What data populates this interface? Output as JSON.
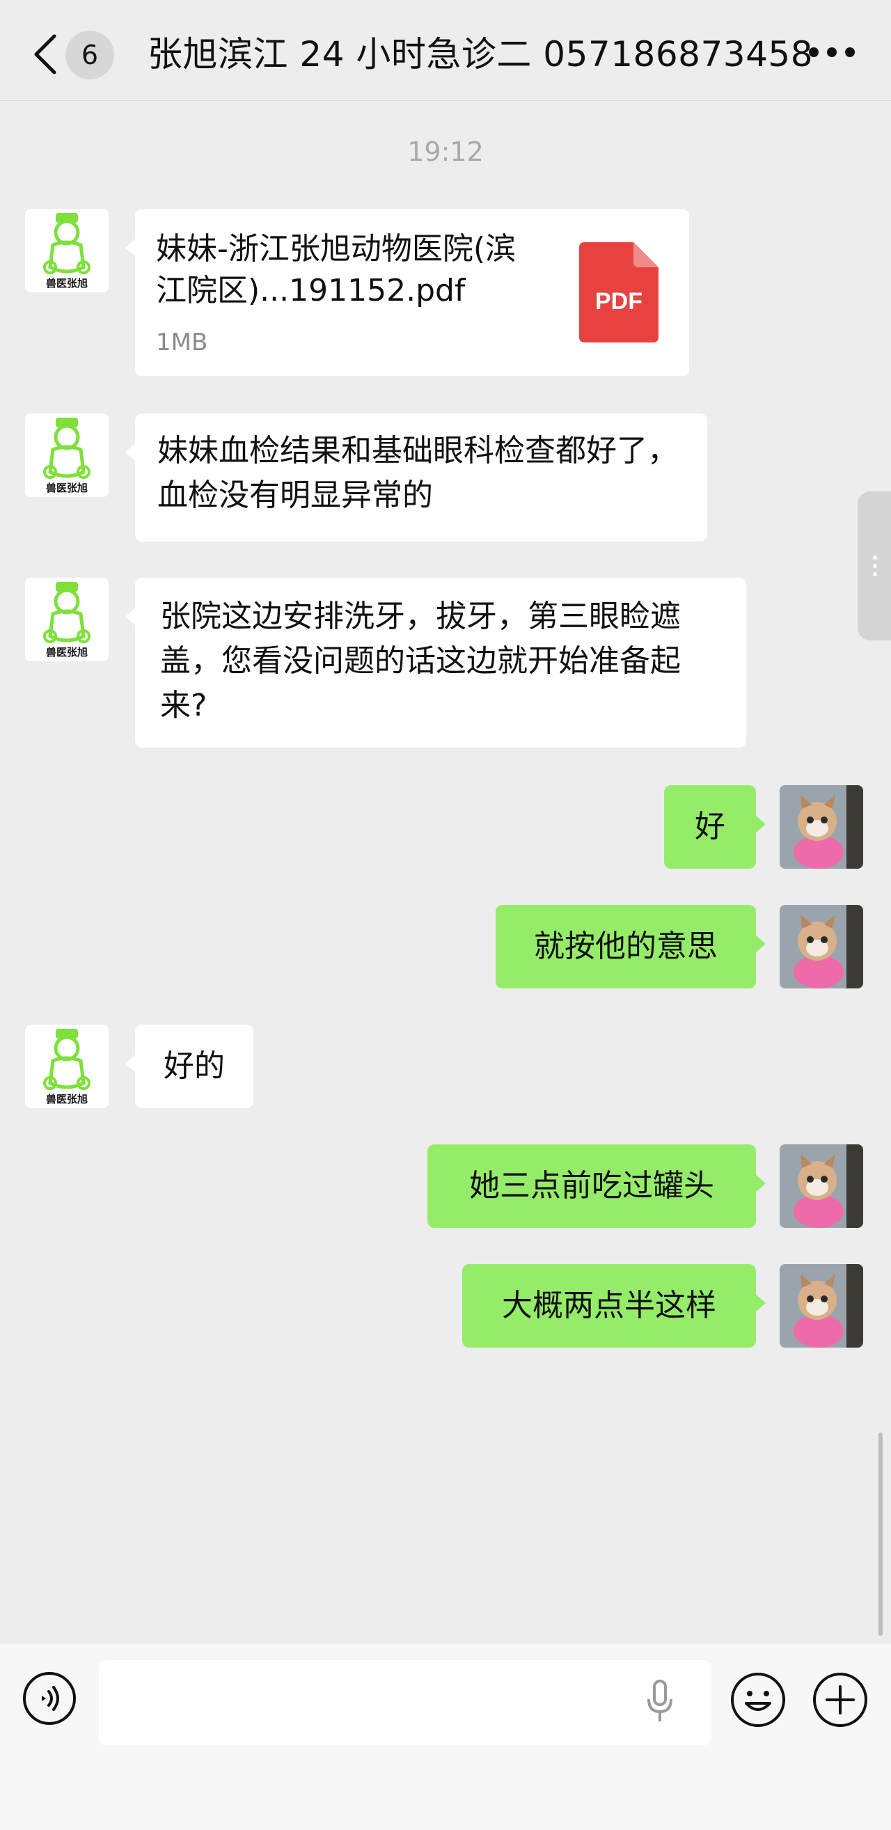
{
  "header": {
    "unread_count": "6",
    "title": "张旭滨江 24 小时急诊二 057186873458"
  },
  "timestamp": "19:12",
  "messages": [
    {
      "sender": "doctor",
      "type": "file",
      "file_name": "妹妹-浙江张旭动物医院(滨江院区)...191152.pdf",
      "file_size": "1MB",
      "file_icon": "PDF"
    },
    {
      "sender": "doctor",
      "type": "text",
      "text": "妹妹血检结果和基础眼科检查都好了，血检没有明显异常的"
    },
    {
      "sender": "doctor",
      "type": "text",
      "text": "张院这边安排洗牙，拔牙，第三眼睑遮盖，您看没问题的话这边就开始准备起来?"
    },
    {
      "sender": "me",
      "type": "text",
      "text": "好"
    },
    {
      "sender": "me",
      "type": "text",
      "text": "就按他的意思"
    },
    {
      "sender": "doctor",
      "type": "text",
      "text": "好的"
    },
    {
      "sender": "me",
      "type": "text",
      "text": "她三点前吃过罐头"
    },
    {
      "sender": "me",
      "type": "text",
      "text": "大概两点半这样"
    }
  ],
  "doctor_avatar_text": "兽医张旭",
  "colors": {
    "background": "#ededed",
    "outgoing_bubble": "#95ec69",
    "incoming_bubble": "#ffffff",
    "pdf_red": "#e64340",
    "logo_green": "#7ee03a"
  },
  "input": {
    "value": "",
    "placeholder": ""
  }
}
